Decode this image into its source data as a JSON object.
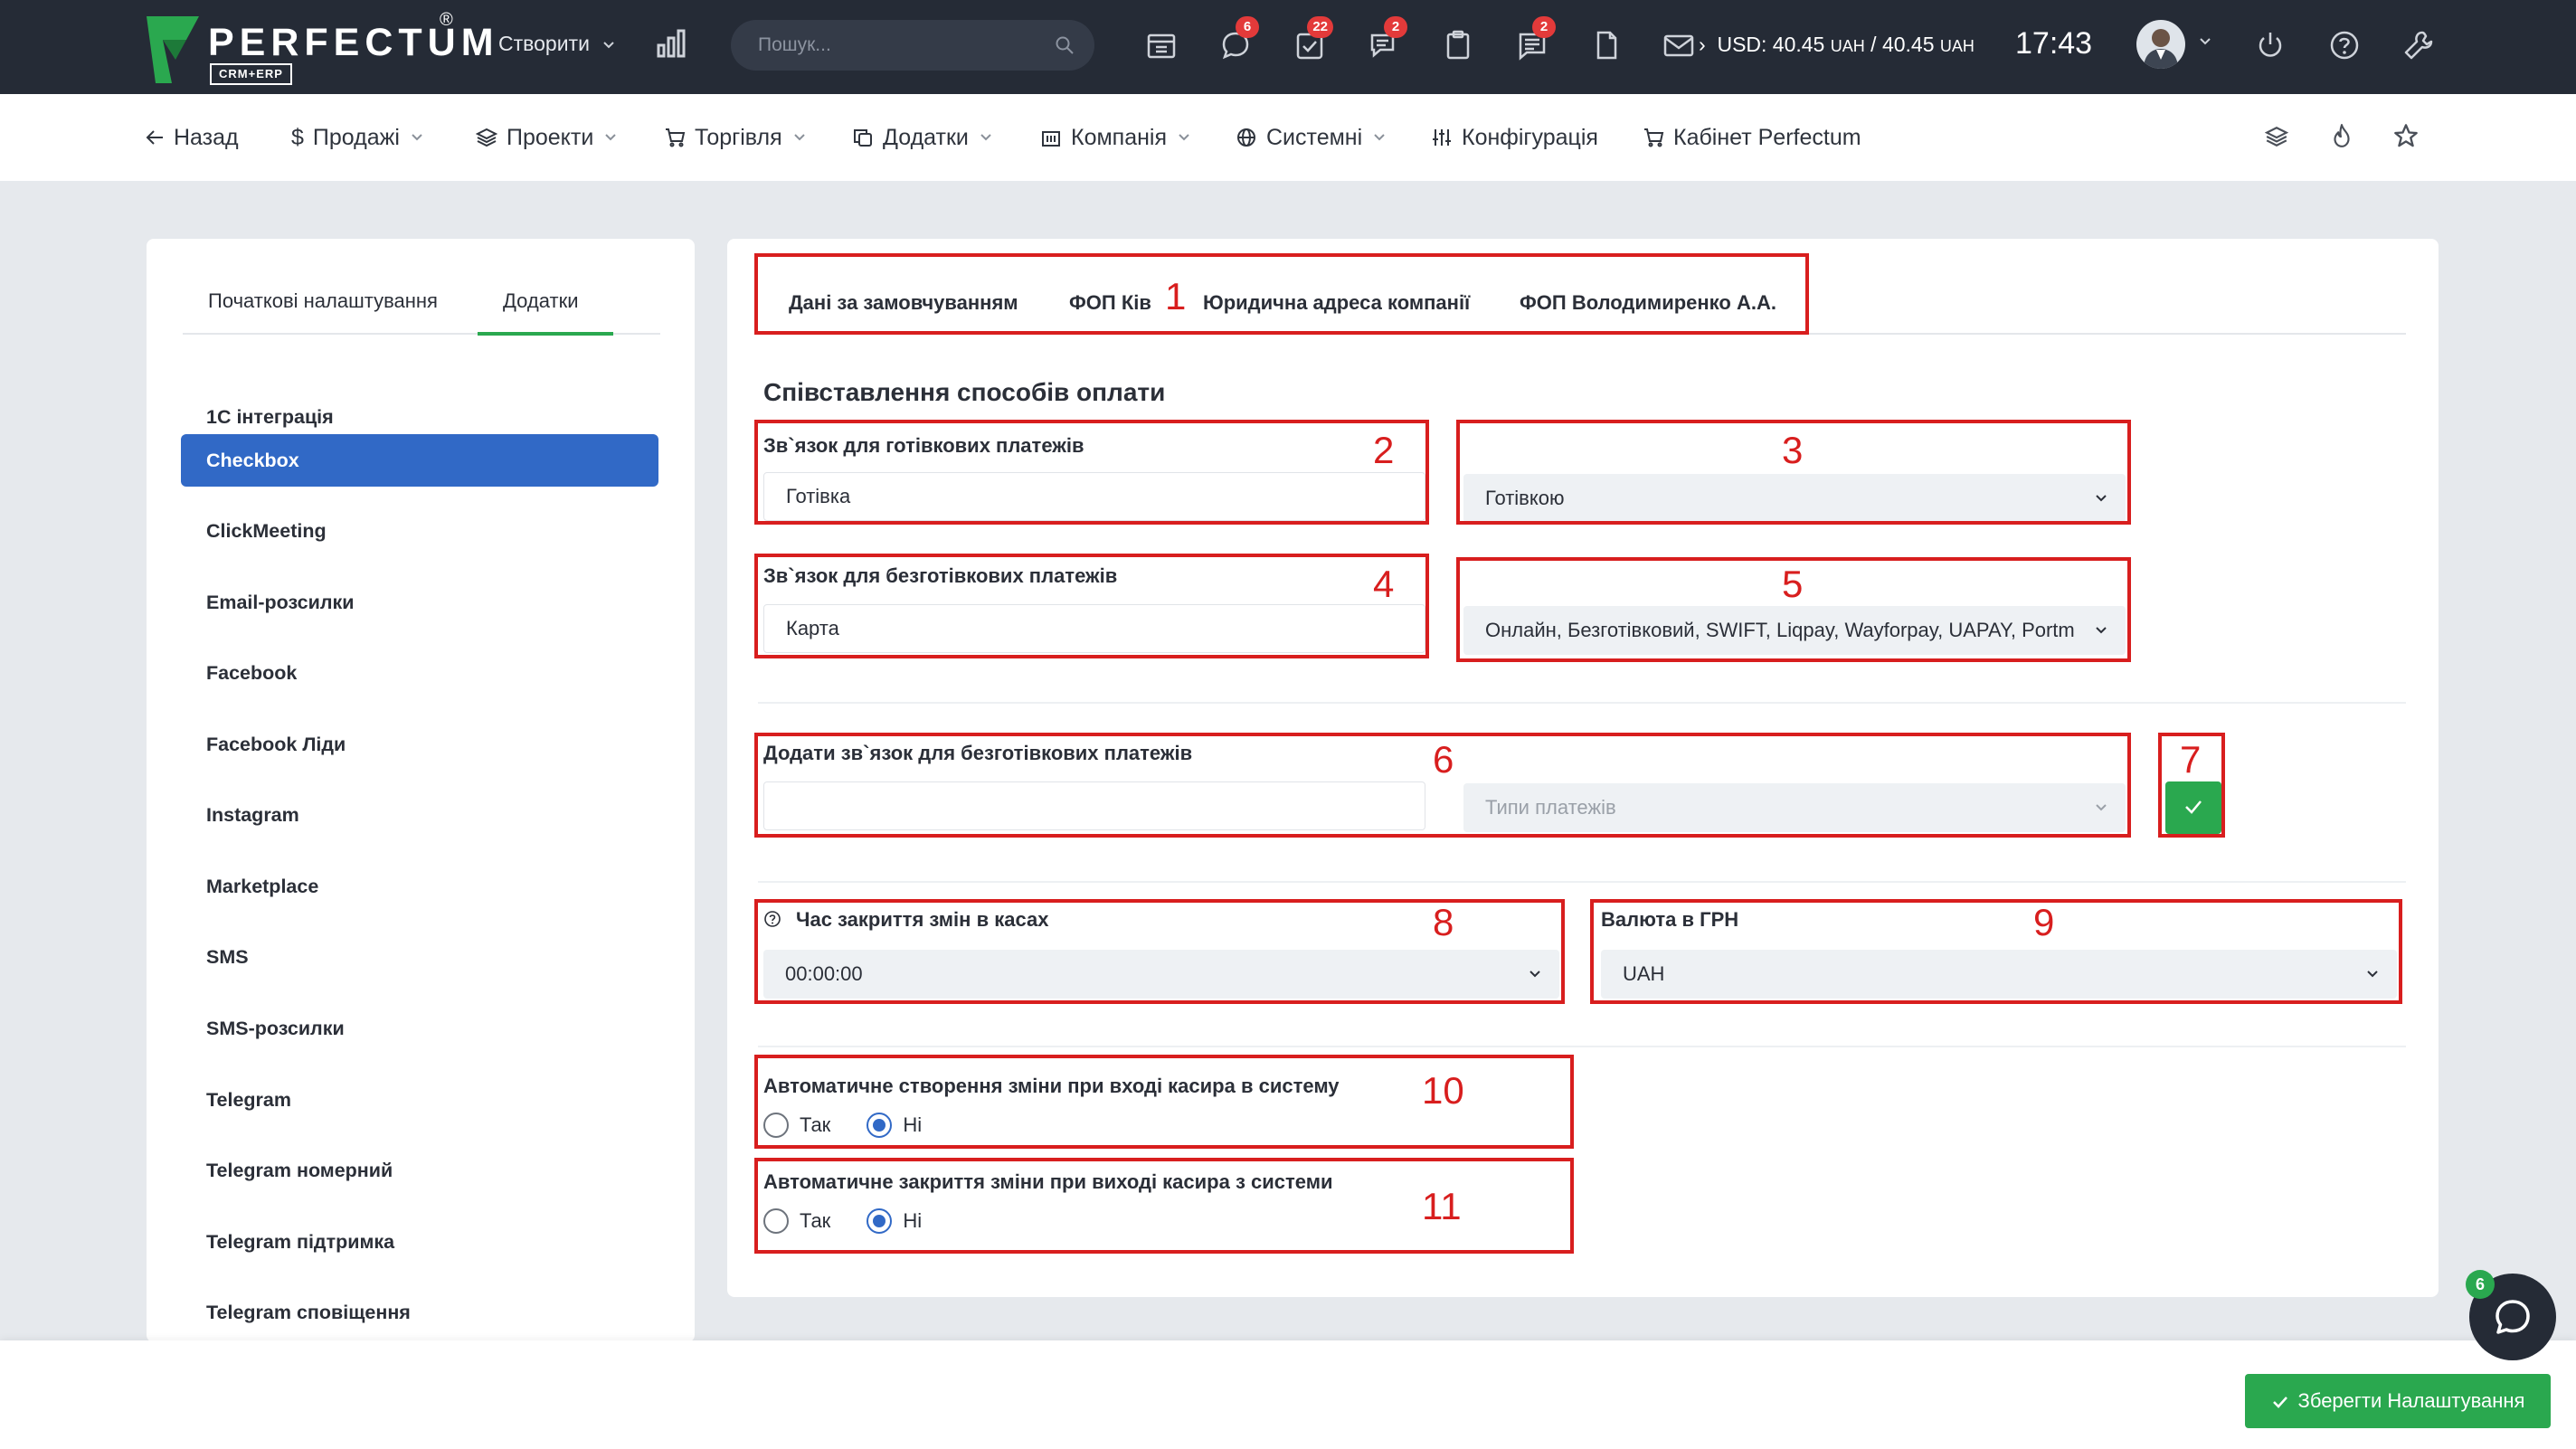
{
  "brand": {
    "name": "PERFECTUM",
    "reg": "®",
    "sub": "CRM+ERP",
    "logo_color": "#2aa84f"
  },
  "topbar": {
    "create_label": "Створити",
    "search_placeholder": "Пошук...",
    "badges": {
      "chat": "6",
      "tasks": "22",
      "messages": "2",
      "notes": "2"
    },
    "currency": {
      "usd_label": "USD:",
      "value1": "40.45",
      "unit1": "UAH",
      "sep": "/",
      "value2": "40.45",
      "unit2": "UAH"
    },
    "time": "17:43"
  },
  "nav": {
    "back": "Назад",
    "sales": "Продажі",
    "projects": "Проекти",
    "trade": "Торгівля",
    "addons": "Додатки",
    "company": "Компанія",
    "system": "Системні",
    "config": "Конфігурація",
    "cabinet": "Кабінет Perfectum"
  },
  "sidebar": {
    "tabs": [
      {
        "label": "Початкові налаштування"
      },
      {
        "label": "Додатки"
      }
    ],
    "items": [
      {
        "label": "1С інтеграція"
      },
      {
        "label": "Checkbox"
      },
      {
        "label": "ClickMeeting"
      },
      {
        "label": "Email-розсилки"
      },
      {
        "label": "Facebook"
      },
      {
        "label": "Facebook Ліди"
      },
      {
        "label": "Instagram"
      },
      {
        "label": "Marketplace"
      },
      {
        "label": "SMS"
      },
      {
        "label": "SMS-розсилки"
      },
      {
        "label": "Telegram"
      },
      {
        "label": "Telegram номерний"
      },
      {
        "label": "Telegram підтримка"
      },
      {
        "label": "Telegram сповіщення"
      }
    ]
  },
  "main": {
    "tabs": [
      {
        "label": "Дані за замовчуванням"
      },
      {
        "label": "ФОП Ків"
      },
      {
        "label": "Юридична адреса компанії"
      },
      {
        "label": "ФОП Володимиренко А.А."
      }
    ],
    "section_title": "Співставлення способів оплати",
    "cash_label": "Зв`язок для готівкових платежів",
    "cash_value": "Готівка",
    "cash_select": "Готівкою",
    "noncash_label": "Зв`язок для безготівкових платежів",
    "noncash_value": "Карта",
    "noncash_select": "Онлайн, Безготівковий, SWIFT, Liqpay, Wayforpay, UAPAY, Portm",
    "add_label": "Додати зв`язок для безготівкових платежів",
    "add_value": "",
    "payment_types_placeholder": "Типи платежів",
    "close_time_label": "Час закриття змін в касах",
    "close_time_value": "00:00:00",
    "currency_label": "Валюта в ГРН",
    "currency_value": "UAH",
    "auto_open_label": "Автоматичне створення зміни при вході касира в систему",
    "auto_close_label": "Автоматичне закриття зміни при виході касира з системи",
    "yes": "Так",
    "no": "Ні",
    "auto_open_selected": "Ні",
    "auto_close_selected": "Ні"
  },
  "annotations": [
    "1",
    "2",
    "3",
    "4",
    "5",
    "6",
    "7",
    "8",
    "9",
    "10",
    "11"
  ],
  "footer": {
    "save_label": "Зберегти Налаштування"
  },
  "chat_badge": "6",
  "colors": {
    "topbar": "#252b36",
    "accent_green": "#2aa84f",
    "active_blue": "#3169c6",
    "annotation_red": "#d81e1e",
    "badge_red": "#e33a3a"
  }
}
